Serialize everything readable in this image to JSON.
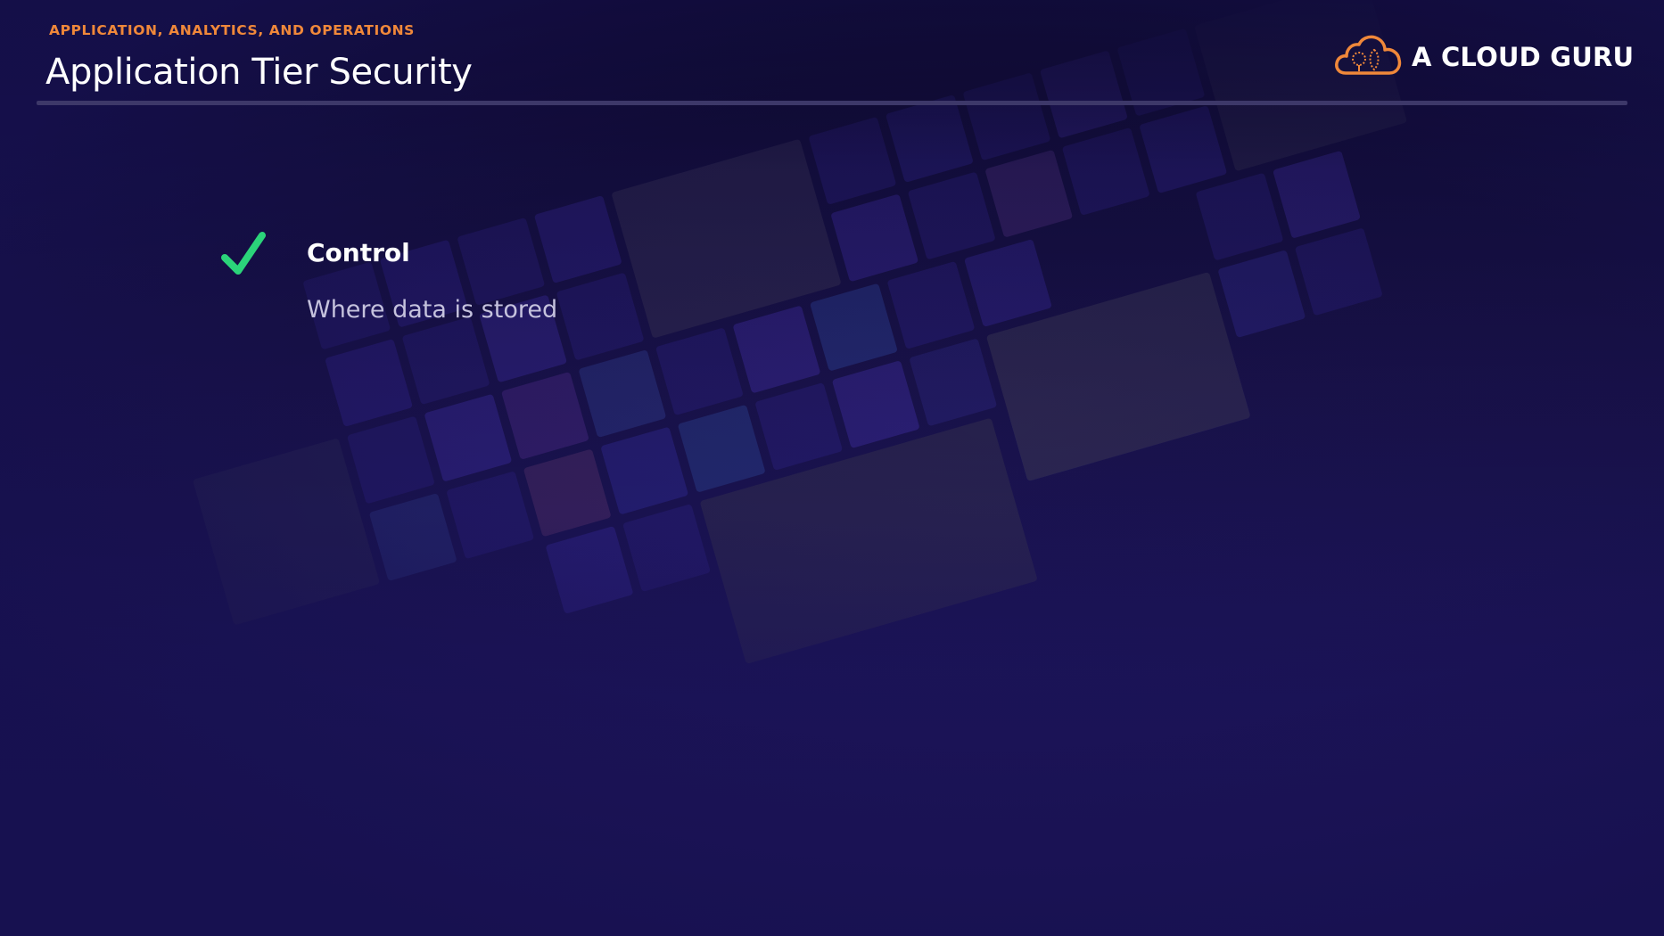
{
  "slide": {
    "section_label": "APPLICATION, ANALYTICS, AND OPERATIONS",
    "title": "Application Tier Security"
  },
  "brand": {
    "name": "A CLOUD GURU",
    "logo_icon": "cloud-logo-icon",
    "accent_color": "#f0883a"
  },
  "bullets": [
    {
      "icon": "checkmark-icon",
      "icon_color": "#2bd47a",
      "heading": "Control",
      "detail": "Where data is stored"
    }
  ],
  "colors": {
    "background": "#19124a",
    "text": "#ffffff",
    "muted_text": "#c5c2dd",
    "divider": "#3d3869"
  }
}
